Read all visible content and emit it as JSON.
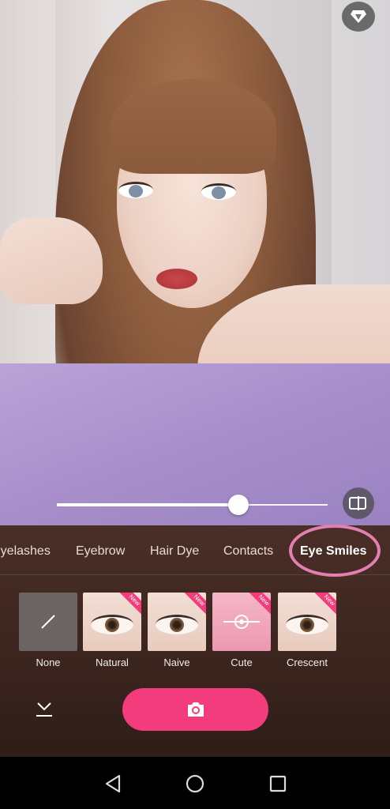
{
  "tabs": [
    {
      "label": "Eyelashes",
      "active": false
    },
    {
      "label": "Eyebrow",
      "active": false
    },
    {
      "label": "Hair Dye",
      "active": false
    },
    {
      "label": "Contacts",
      "active": false
    },
    {
      "label": "Eye Smiles",
      "active": true
    }
  ],
  "intensity_fraction": 0.67,
  "styles": [
    {
      "label": "None",
      "is_new": false,
      "icon": "slash-icon"
    },
    {
      "label": "Natural",
      "is_new": true,
      "badge": "New"
    },
    {
      "label": "Naive",
      "is_new": true,
      "badge": "New"
    },
    {
      "label": "Cute",
      "is_new": true,
      "badge": "New"
    },
    {
      "label": "Crescent",
      "is_new": true,
      "badge": "New"
    }
  ],
  "icons": {
    "premium": "diamond-icon",
    "compare": "compare-icon",
    "download": "download-icon",
    "capture": "camera-icon",
    "nav_back": "back-triangle-icon",
    "nav_home": "home-circle-icon",
    "nav_recents": "recents-square-icon"
  },
  "colors": {
    "accent": "#f23c7b",
    "highlight_ring": "#e47fb1",
    "panel": "#3a241e"
  }
}
